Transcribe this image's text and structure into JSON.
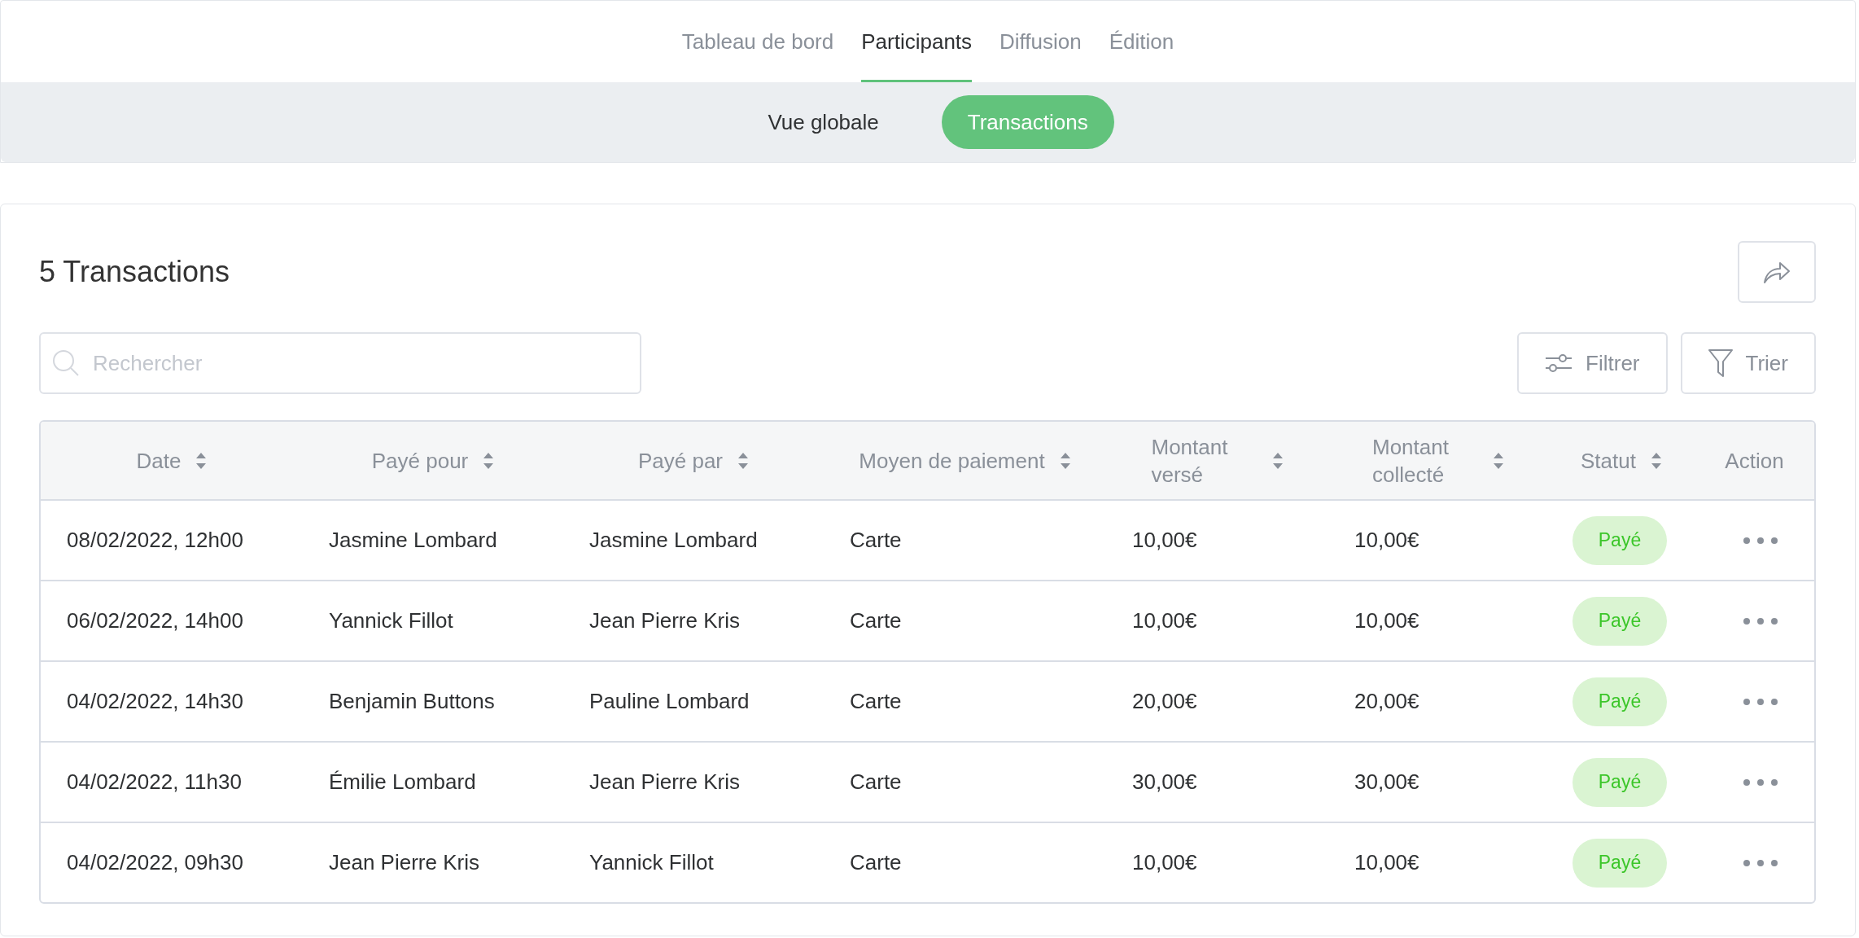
{
  "tabs": [
    {
      "label": "Tableau de bord",
      "selected": false
    },
    {
      "label": "Participants",
      "selected": true
    },
    {
      "label": "Diffusion",
      "selected": false
    },
    {
      "label": "Édition",
      "selected": false
    }
  ],
  "subtabs": [
    {
      "label": "Vue globale",
      "selected": false
    },
    {
      "label": "Transactions",
      "selected": true
    }
  ],
  "title": "5 Transactions",
  "search": {
    "placeholder": "Rechercher"
  },
  "buttons": [
    {
      "label": "Filtrer",
      "kind": "filter"
    },
    {
      "label": "Trier",
      "kind": "sort"
    }
  ],
  "table": {
    "columns": [
      {
        "label": "Date",
        "sortable": true
      },
      {
        "label": "Payé pour",
        "sortable": true
      },
      {
        "label": "Payé par",
        "sortable": true
      },
      {
        "label": "Moyen de paiement",
        "sortable": true
      },
      {
        "label": "Montant versé",
        "sortable": true
      },
      {
        "label": "Montant collecté",
        "sortable": true
      },
      {
        "label": "Statut",
        "sortable": true
      },
      {
        "label": "Action",
        "sortable": false
      }
    ],
    "rows": [
      {
        "cells": [
          "08/02/2022, 12h00",
          "Jasmine Lombard",
          "Jasmine Lombard",
          "Carte",
          "10,00€",
          "10,00€"
        ],
        "status": "Payé"
      },
      {
        "cells": [
          "06/02/2022, 14h00",
          "Yannick Fillot",
          "Jean Pierre Kris",
          "Carte",
          "10,00€",
          "10,00€"
        ],
        "status": "Payé"
      },
      {
        "cells": [
          "04/02/2022, 14h30",
          "Benjamin Buttons",
          "Pauline Lombard",
          "Carte",
          "20,00€",
          "20,00€"
        ],
        "status": "Payé"
      },
      {
        "cells": [
          "04/02/2022, 11h30",
          "Émilie Lombard",
          "Jean Pierre Kris",
          "Carte",
          "30,00€",
          "30,00€"
        ],
        "status": "Payé"
      },
      {
        "cells": [
          "04/02/2022, 09h30",
          "Jean Pierre Kris",
          "Yannick Fillot",
          "Carte",
          "10,00€",
          "10,00€"
        ],
        "status": "Payé"
      }
    ]
  }
}
